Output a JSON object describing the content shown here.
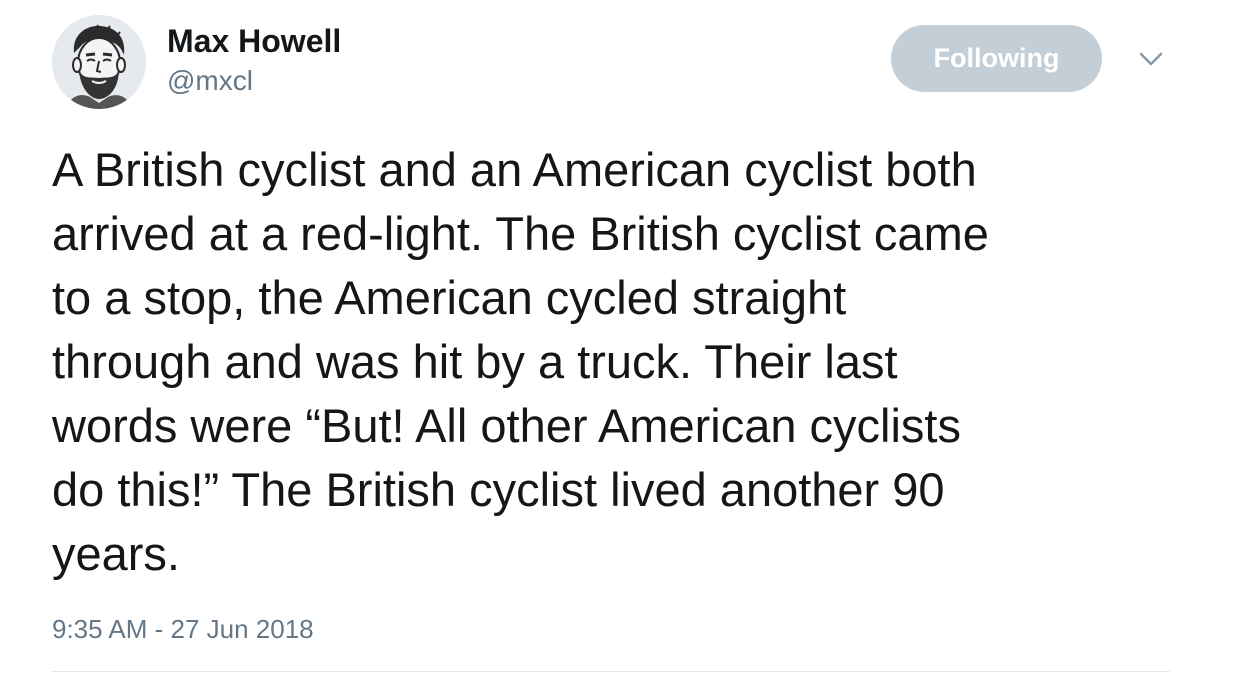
{
  "user": {
    "display_name": "Max Howell",
    "handle": "@mxcl",
    "avatar_icon": "sketch-portrait-avatar"
  },
  "actions": {
    "follow_label": "Following",
    "follow_color": "#c4ced6",
    "menu_icon": "chevron-down-icon"
  },
  "tweet": {
    "text": "A British cyclist and an American cyclist both\narrived at a red-light. The British cyclist came\nto a stop, the American cycled straight\nthrough and was hit by a truck. Their last\nwords were “But! All other American cyclists\ndo this!” The British cyclist lived another 90\nyears.",
    "timestamp": "9:35 AM - 27 Jun 2018"
  },
  "colors": {
    "text_primary": "#14171a",
    "text_secondary": "#657786",
    "divider": "#e1e8ed"
  }
}
